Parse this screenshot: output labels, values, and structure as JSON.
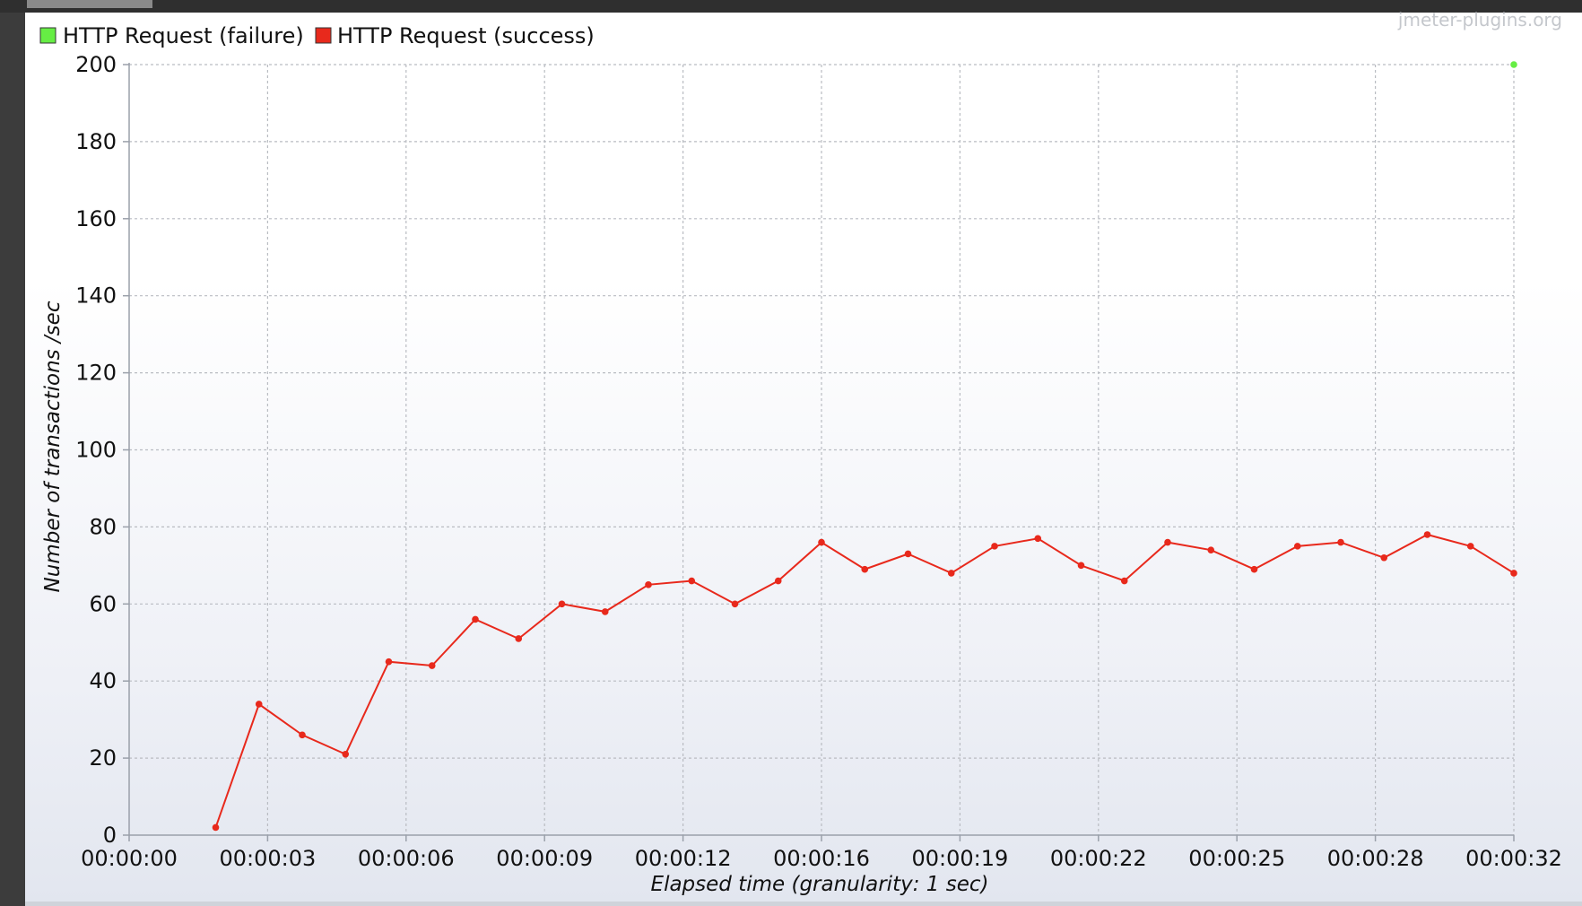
{
  "watermark": "jmeter-plugins.org",
  "legend": [
    {
      "label": "HTTP Request (failure)",
      "color": "#66ee44"
    },
    {
      "label": "HTTP Request (success)",
      "color": "#e8291c"
    }
  ],
  "chart_data": {
    "type": "line",
    "xlabel": "Elapsed time (granularity: 1 sec)",
    "ylabel": "Number of transactions /sec",
    "ylim": [
      0,
      200
    ],
    "yticks": [
      0,
      20,
      40,
      60,
      80,
      100,
      120,
      140,
      160,
      180,
      200
    ],
    "xlim_seconds": [
      0,
      32
    ],
    "xticks": [
      {
        "label": "00:00:00",
        "t": 0
      },
      {
        "label": "00:00:03",
        "t": 3.2
      },
      {
        "label": "00:00:06",
        "t": 6.4
      },
      {
        "label": "00:00:09",
        "t": 9.6
      },
      {
        "label": "00:00:12",
        "t": 12.8
      },
      {
        "label": "00:00:16",
        "t": 16
      },
      {
        "label": "00:00:19",
        "t": 19.2
      },
      {
        "label": "00:00:22",
        "t": 22.4
      },
      {
        "label": "00:00:25",
        "t": 25.6
      },
      {
        "label": "00:00:28",
        "t": 28.8
      },
      {
        "label": "00:00:32",
        "t": 32
      }
    ],
    "grid": true,
    "legend_position": "top-left",
    "series": [
      {
        "name": "HTTP Request (failure)",
        "color": "#66ee44",
        "points": [
          [
            32,
            200
          ]
        ]
      },
      {
        "name": "HTTP Request (success)",
        "color": "#e8291c",
        "points": [
          [
            2,
            2
          ],
          [
            3,
            34
          ],
          [
            4,
            26
          ],
          [
            5,
            21
          ],
          [
            6,
            45
          ],
          [
            7,
            44
          ],
          [
            8,
            56
          ],
          [
            9,
            51
          ],
          [
            10,
            60
          ],
          [
            11,
            58
          ],
          [
            12,
            65
          ],
          [
            13,
            66
          ],
          [
            14,
            60
          ],
          [
            15,
            66
          ],
          [
            16,
            76
          ],
          [
            17,
            69
          ],
          [
            18,
            73
          ],
          [
            19,
            68
          ],
          [
            20,
            75
          ],
          [
            21,
            77
          ],
          [
            22,
            70
          ],
          [
            23,
            66
          ],
          [
            24,
            76
          ],
          [
            25,
            74
          ],
          [
            26,
            69
          ],
          [
            27,
            75
          ],
          [
            28,
            76
          ],
          [
            29,
            72
          ],
          [
            30,
            78
          ],
          [
            31,
            75
          ],
          [
            32,
            68
          ]
        ]
      }
    ]
  }
}
